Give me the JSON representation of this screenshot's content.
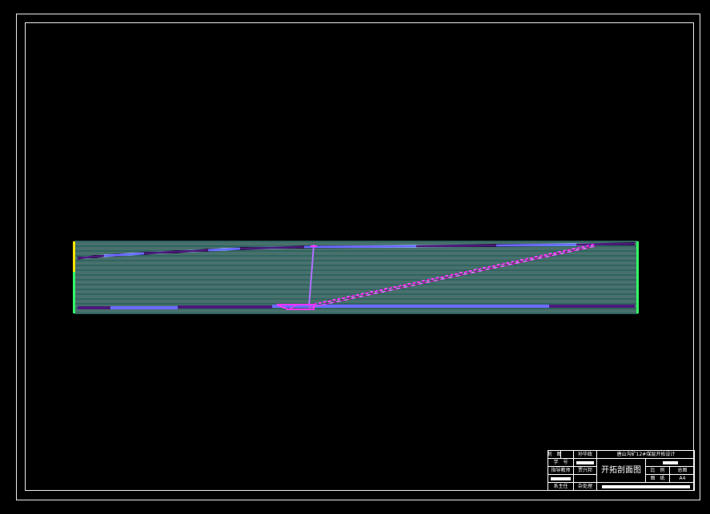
{
  "title_block": {
    "project_title": "唐山沟矿12#煤层开拓设计",
    "drawing_name": "开拓剖面图",
    "rows_left": [
      {
        "label": "制　图",
        "value": "孙华政"
      },
      {
        "label": "学　号",
        "value": ""
      },
      {
        "label": "指导教师",
        "value": "贾兴邦"
      },
      {
        "label": "",
        "value": ""
      },
      {
        "label": "系主任",
        "value": "杂处理"
      }
    ],
    "ratio_label": "比　例",
    "scale_label": "总图",
    "sheet_label": "图　纸",
    "sheet_value": "A4"
  },
  "colors": {
    "background": "#000000",
    "frame": "#e8e8e8",
    "strata": "#8fe0d8",
    "strata_alt": "#5fc9bf",
    "coal_seam": "#6b6bff",
    "coal_seam_dark": "#4a1a7a",
    "roadway": "#ff33ff",
    "shaft": "#b070ff",
    "left_edge": "#ffe600",
    "right_edge": "#33ff66"
  }
}
